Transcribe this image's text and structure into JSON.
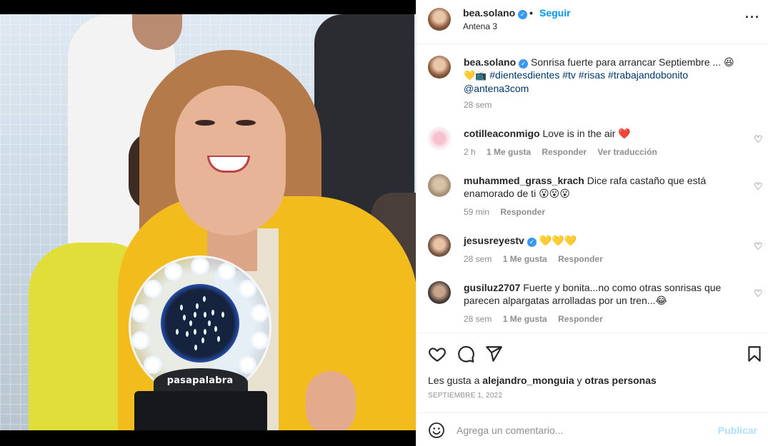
{
  "post": {
    "username": "bea.solano",
    "follow_label": "Seguir",
    "bullet": "•",
    "location": "Antena 3",
    "media_brand_text": "pasapalabra"
  },
  "caption": {
    "username": "bea.solano",
    "text": "Sonrisa fuerte para arrancar Septiembre ... 😆",
    "line2_prefix": "💛📺",
    "hashtags": "#dientesdientes #tv #risas #trabajandobonito",
    "mention": "@antena3com",
    "time": "28 sem"
  },
  "comments": [
    {
      "username": "cotilleaconmigo",
      "text": "Love is in the air ❤️",
      "time": "2 h",
      "likes": "1 Me gusta",
      "reply": "Responder",
      "translate": "Ver traducción"
    },
    {
      "username": "muhammed_grass_krach",
      "text": "Dice rafa castaño que está enamorado de ti 😮😮😮",
      "time": "59 min",
      "reply": "Responder"
    },
    {
      "username": "jesusreyestv",
      "text": "💛💛💛",
      "time": "28 sem",
      "likes": "1 Me gusta",
      "reply": "Responder"
    },
    {
      "username": "gusiluz2707",
      "text": "Fuerte y bonita...no como otras sonrisas que parecen alpargatas arrolladas por un tren...😂",
      "time": "28 sem",
      "likes": "1 Me gusta",
      "reply": "Responder"
    }
  ],
  "likes": {
    "prefix": "Les gusta a",
    "user": "alejandro_monguia",
    "conj": "y",
    "others": "otras personas"
  },
  "date": "SEPTIEMBRE 1, 2022",
  "add_comment": {
    "placeholder": "Agrega un comentario...",
    "post_label": "Publicar"
  },
  "icons": {
    "verified": "verified-badge",
    "more": "more-options-icon",
    "like": "heart-icon",
    "comment": "comment-icon",
    "share": "send-icon",
    "save": "bookmark-icon",
    "emoji": "emoji-icon"
  },
  "colors": {
    "accent": "#0095f6",
    "verified": "#3897f0",
    "hashtag": "#00376b",
    "muted": "#8e8e8e",
    "publish_disabled": "#b2dffc"
  }
}
